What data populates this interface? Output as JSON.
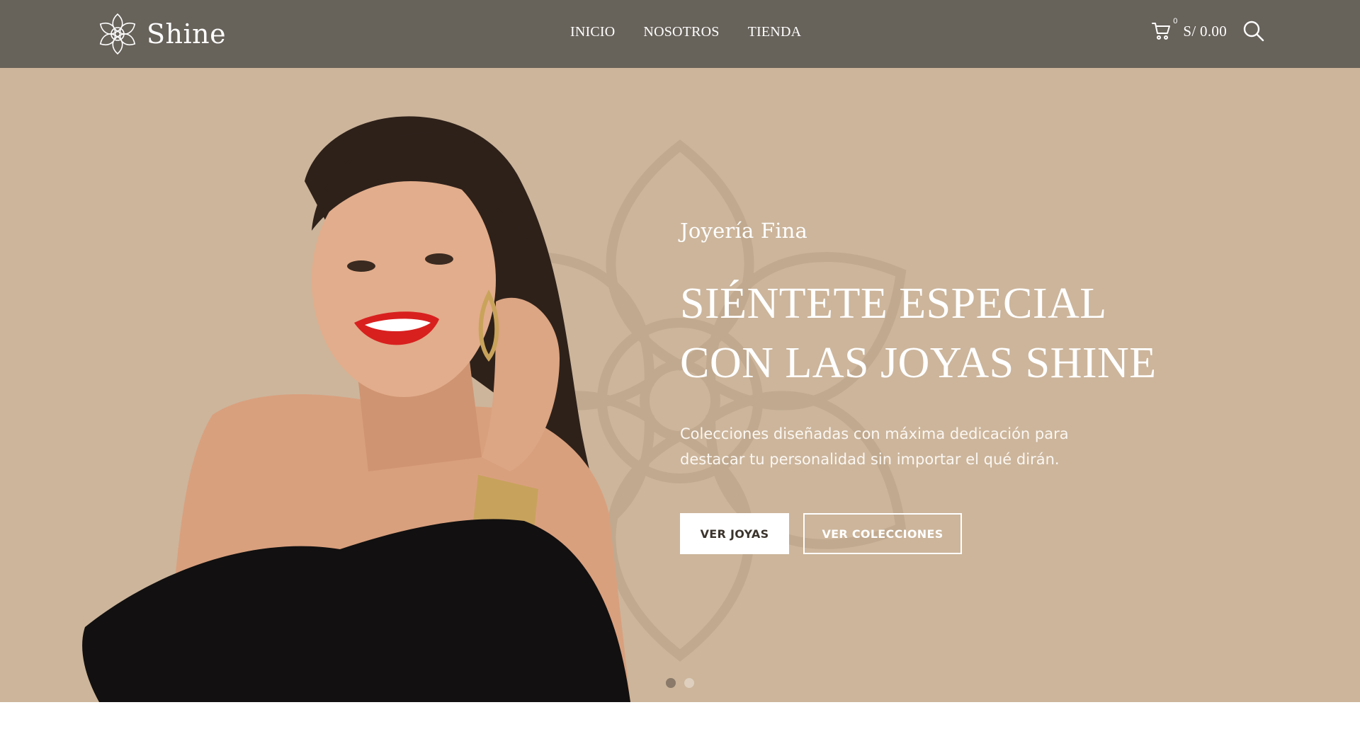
{
  "header": {
    "brand_name": "Shine",
    "logo_icon": "flower-logo-icon",
    "background": "#67625a",
    "nav": [
      {
        "label": "INICIO"
      },
      {
        "label": "NOSOTROS"
      },
      {
        "label": "TIENDA"
      }
    ],
    "cart": {
      "count": "0",
      "total": "S/ 0.00",
      "icon": "cart-icon"
    },
    "search_icon": "search-icon"
  },
  "hero": {
    "background": "#ccb59b",
    "eyebrow": "Joyería Fina",
    "headline_line1": "SIÉNTETE ESPECIAL",
    "headline_line2": "CON LAS JOYAS SHINE",
    "description_line1": "Colecciones diseñadas con máxima dedicación para",
    "description_line2": "destacar tu personalidad sin importar el qué dirán.",
    "primary_button": "VER JOYAS",
    "secondary_button": "VER COLECCIONES",
    "slides": 2,
    "active_slide": 1
  }
}
